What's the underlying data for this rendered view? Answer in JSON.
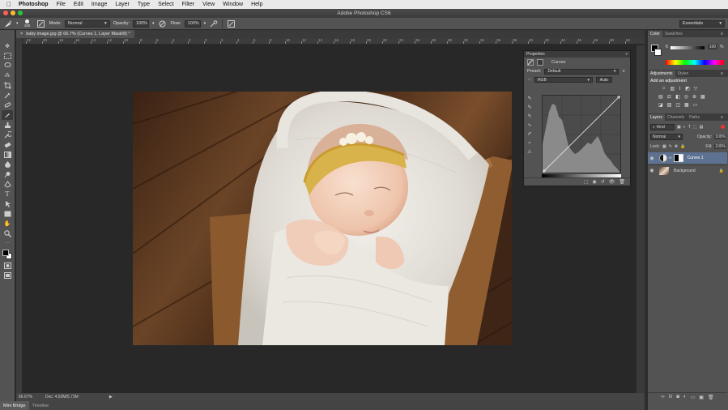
{
  "menubar": {
    "app": "Photoshop",
    "items": [
      "File",
      "Edit",
      "Image",
      "Layer",
      "Type",
      "Select",
      "Filter",
      "View",
      "Window",
      "Help"
    ]
  },
  "window_title": "Adobe Photoshop CS6",
  "options_bar": {
    "brush_size": "180",
    "mode_label": "Mode:",
    "mode_value": "Normal",
    "opacity_label": "Opacity:",
    "opacity_value": "100%",
    "flow_label": "Flow:",
    "flow_value": "100%",
    "workspace": "Essentials"
  },
  "document_tab": {
    "title": "baby image.jpg @ 66.7% (Curves 1, Layer Mask/8) *",
    "close": "×"
  },
  "ruler_ticks": [
    "22",
    "20",
    "18",
    "16",
    "14",
    "12",
    "10",
    "8",
    "6",
    "4",
    "2",
    "0",
    "2",
    "4",
    "6",
    "8",
    "10",
    "12",
    "14",
    "16",
    "18",
    "20",
    "22",
    "24",
    "26",
    "28",
    "30",
    "32",
    "34",
    "36",
    "38",
    "40",
    "42",
    "44",
    "46",
    "48",
    "50",
    "52",
    "54"
  ],
  "status": {
    "zoom": "66.67%",
    "doc": "Doc: 4.50M/5.73M"
  },
  "bottom_tabs": [
    "Mini Bridge",
    "Timeline"
  ],
  "properties": {
    "panel_title": "Properties",
    "adjustment": "Curves",
    "preset_label": "Preset:",
    "preset_value": "Default",
    "channel_value": "RGB",
    "auto_label": "Auto",
    "curve": {
      "input": [
        0,
        255
      ],
      "output": [
        0,
        255
      ]
    }
  },
  "color_panel": {
    "tabs": [
      "Color",
      "Swatches"
    ],
    "slider_label": "K",
    "value": "100",
    "unit": "%"
  },
  "adjustments_panel": {
    "tabs": [
      "Adjustments",
      "Styles"
    ],
    "heading": "Add an adjustment"
  },
  "layers_panel": {
    "tabs": [
      "Layers",
      "Channels",
      "Paths"
    ],
    "filter_kind": "Kind",
    "blend_mode": "Normal",
    "opacity_label": "Opacity:",
    "opacity_value": "100%",
    "lock_label": "Lock:",
    "fill_label": "Fill:",
    "fill_value": "100%",
    "layers": [
      {
        "name": "Curves 1",
        "selected": true
      },
      {
        "name": "Background",
        "selected": false
      }
    ]
  },
  "icons": {
    "close": "close-icon",
    "eye": "eye-icon",
    "lock": "lock-icon"
  },
  "colors": {
    "panel": "#535353",
    "panel_dark": "#3c3c3c",
    "canvas_bg": "#282828",
    "layer_selected": "#5d7291"
  }
}
